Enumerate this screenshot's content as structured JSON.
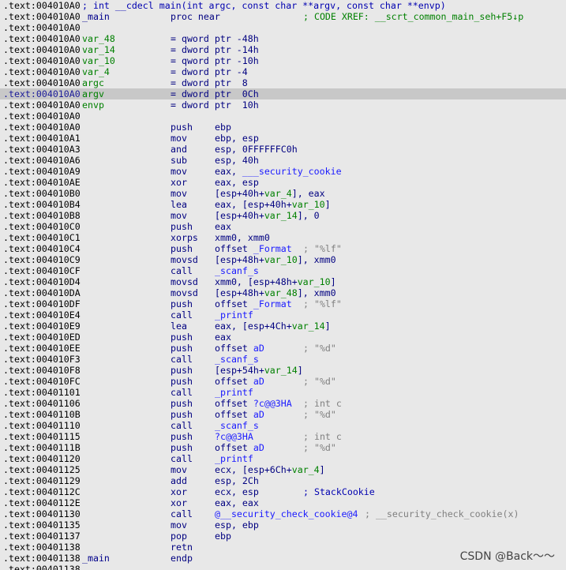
{
  "lines": [
    {
      "addr": ".text:004010A0",
      "header": "; int __cdecl main(int argc, const char **argv, const char **envp)"
    },
    {
      "addr": ".text:004010A0",
      "label": "_main",
      "mnem": "proc near",
      "comment": "; CODE XREF: __scrt_common_main_seh+F5↓p"
    },
    {
      "addr": ".text:004010A0"
    },
    {
      "addr": ".text:004010A0",
      "var": "var_48",
      "mnem": "= qword ptr -48h"
    },
    {
      "addr": ".text:004010A0",
      "var": "var_14",
      "mnem": "= dword ptr -14h"
    },
    {
      "addr": ".text:004010A0",
      "var": "var_10",
      "mnem": "= qword ptr -10h"
    },
    {
      "addr": ".text:004010A0",
      "var": "var_4",
      "mnem": "= dword ptr -4"
    },
    {
      "addr": ".text:004010A0",
      "var": "argc",
      "mnem": "= dword ptr  8"
    },
    {
      "addr": ".text:004010A0",
      "var": "argv",
      "mnem": "= dword ptr  0Ch",
      "selected": true
    },
    {
      "addr": ".text:004010A0",
      "var": "envp",
      "mnem": "= dword ptr  10h"
    },
    {
      "addr": ".text:004010A0"
    },
    {
      "addr": ".text:004010A0",
      "mnem": "push",
      "ops": "ebp"
    },
    {
      "addr": ".text:004010A1",
      "mnem": "mov",
      "ops": "ebp, esp"
    },
    {
      "addr": ".text:004010A3",
      "mnem": "and",
      "ops": "esp, 0FFFFFFC0h"
    },
    {
      "addr": ".text:004010A6",
      "mnem": "sub",
      "ops": "esp, 40h"
    },
    {
      "addr": ".text:004010A9",
      "mnem": "mov",
      "ops_pre": "eax, ",
      "ops_blue": "___security_cookie"
    },
    {
      "addr": ".text:004010AE",
      "mnem": "xor",
      "ops": "eax, esp"
    },
    {
      "addr": ".text:004010B0",
      "mnem": "mov",
      "ops_pre": "[esp+40h+",
      "ops_green": "var_4",
      "ops_post": "], eax"
    },
    {
      "addr": ".text:004010B4",
      "mnem": "lea",
      "ops_pre": "eax, [esp+40h+",
      "ops_green": "var_10",
      "ops_post": "]"
    },
    {
      "addr": ".text:004010B8",
      "mnem": "mov",
      "ops_pre": "[esp+40h+",
      "ops_green": "var_14",
      "ops_post": "], 0"
    },
    {
      "addr": ".text:004010C0",
      "mnem": "push",
      "ops": "eax"
    },
    {
      "addr": ".text:004010C1",
      "mnem": "xorps",
      "ops": "xmm0, xmm0"
    },
    {
      "addr": ".text:004010C4",
      "mnem": "push",
      "ops_pre": "offset ",
      "ops_blue": "_Format",
      "comment": "; \"%lf\""
    },
    {
      "addr": ".text:004010C9",
      "mnem": "movsd",
      "ops_pre": "[esp+48h+",
      "ops_green": "var_10",
      "ops_post": "], xmm0"
    },
    {
      "addr": ".text:004010CF",
      "mnem": "call",
      "ops_blue": "_scanf_s"
    },
    {
      "addr": ".text:004010D4",
      "mnem": "movsd",
      "ops_pre": "xmm0, [esp+48h+",
      "ops_green": "var_10",
      "ops_post": "]"
    },
    {
      "addr": ".text:004010DA",
      "mnem": "movsd",
      "ops_pre": "[esp+48h+",
      "ops_green": "var_48",
      "ops_post": "], xmm0"
    },
    {
      "addr": ".text:004010DF",
      "mnem": "push",
      "ops_pre": "offset ",
      "ops_blue": "_Format",
      "comment": "; \"%lf\""
    },
    {
      "addr": ".text:004010E4",
      "mnem": "call",
      "ops_blue": "_printf"
    },
    {
      "addr": ".text:004010E9",
      "mnem": "lea",
      "ops_pre": "eax, [esp+4Ch+",
      "ops_green": "var_14",
      "ops_post": "]"
    },
    {
      "addr": ".text:004010ED",
      "mnem": "push",
      "ops": "eax"
    },
    {
      "addr": ".text:004010EE",
      "mnem": "push",
      "ops_pre": "offset ",
      "ops_blue": "aD",
      "comment": "; \"%d\""
    },
    {
      "addr": ".text:004010F3",
      "mnem": "call",
      "ops_blue": "_scanf_s"
    },
    {
      "addr": ".text:004010F8",
      "mnem": "push",
      "ops_pre": "[esp+54h+",
      "ops_green": "var_14",
      "ops_post": "]"
    },
    {
      "addr": ".text:004010FC",
      "mnem": "push",
      "ops_pre": "offset ",
      "ops_blue": "aD",
      "comment": "; \"%d\""
    },
    {
      "addr": ".text:00401101",
      "mnem": "call",
      "ops_blue": "_printf"
    },
    {
      "addr": ".text:00401106",
      "mnem": "push",
      "ops_pre": "offset ",
      "ops_blue": "?c@@3HA",
      "comment": "; int c"
    },
    {
      "addr": ".text:0040110B",
      "mnem": "push",
      "ops_pre": "offset ",
      "ops_blue": "aD",
      "comment": "; \"%d\""
    },
    {
      "addr": ".text:00401110",
      "mnem": "call",
      "ops_blue": "_scanf_s"
    },
    {
      "addr": ".text:00401115",
      "mnem": "push",
      "ops_blue": "?c@@3HA",
      "comment": "; int c"
    },
    {
      "addr": ".text:0040111B",
      "mnem": "push",
      "ops_pre": "offset ",
      "ops_blue": "aD",
      "comment": "; \"%d\""
    },
    {
      "addr": ".text:00401120",
      "mnem": "call",
      "ops_blue": "_printf"
    },
    {
      "addr": ".text:00401125",
      "mnem": "mov",
      "ops_pre": "ecx, [esp+6Ch+",
      "ops_green": "var_4",
      "ops_post": "]"
    },
    {
      "addr": ".text:00401129",
      "mnem": "add",
      "ops": "esp, 2Ch"
    },
    {
      "addr": ".text:0040112C",
      "mnem": "xor",
      "ops": "ecx, esp",
      "comment_blue": "; StackCookie"
    },
    {
      "addr": ".text:0040112E",
      "mnem": "xor",
      "ops": "eax, eax"
    },
    {
      "addr": ".text:00401130",
      "mnem": "call",
      "ops_blue": "@__security_check_cookie@4",
      "comment": "; __security_check_cookie(x)"
    },
    {
      "addr": ".text:00401135",
      "mnem": "mov",
      "ops": "esp, ebp"
    },
    {
      "addr": ".text:00401137",
      "mnem": "pop",
      "ops": "ebp"
    },
    {
      "addr": ".text:00401138",
      "mnem": "retn"
    },
    {
      "addr": ".text:00401138",
      "label": "_main",
      "mnem": "endp"
    },
    {
      "addr": ".text:00401138"
    }
  ],
  "watermark": "CSDN @Back～～",
  "colors": {
    "background": "#e8e8e8",
    "selection": "#c8c8c8",
    "mnemonic": "#000080",
    "variable": "#008000",
    "symbol": "#1a1aff",
    "comment": "#808080"
  }
}
